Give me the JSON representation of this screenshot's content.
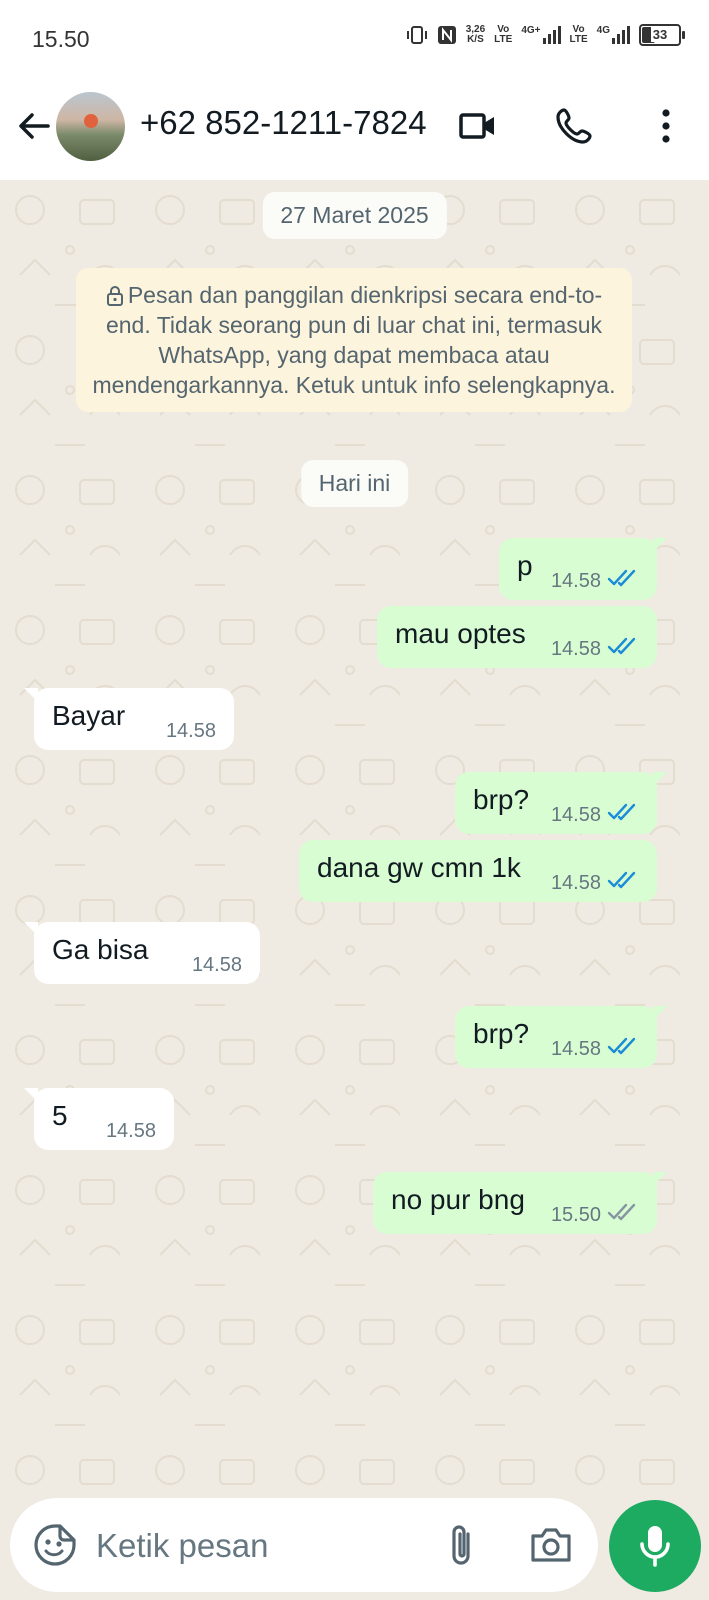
{
  "status_bar": {
    "time": "15.50",
    "net_speed": "3,26",
    "net_unit": "K/S",
    "volte1": "Vo",
    "lte1": "LTE",
    "net1": "4G+",
    "volte2": "Vo",
    "lte2": "LTE",
    "net2": "4G",
    "battery": "33",
    "battery_level": 0.33
  },
  "header": {
    "contact": "+62 852-1211-7824",
    "icons": [
      "back-arrow-icon",
      "video-call-icon",
      "voice-call-icon",
      "more-options-icon"
    ]
  },
  "chat": {
    "date_label": "27 Maret 2025",
    "encryption_notice": "Pesan dan panggilan dienkripsi secara end-to-end. Tidak seorang pun di luar chat ini, termasuk WhatsApp, yang dapat membaca atau mendengarkannya. Ketuk untuk info selengkapnya.",
    "today_label": "Hari ini",
    "messages": [
      {
        "direction": "out",
        "text": "p",
        "time": "14.58",
        "status": "read"
      },
      {
        "direction": "out",
        "text": "mau optes",
        "time": "14.58",
        "status": "read"
      },
      {
        "direction": "in",
        "text": "Bayar",
        "time": "14.58"
      },
      {
        "direction": "out",
        "text": "brp?",
        "time": "14.58",
        "status": "read"
      },
      {
        "direction": "out",
        "text": "dana gw cmn 1k",
        "time": "14.58",
        "status": "read"
      },
      {
        "direction": "in",
        "text": "Ga bisa",
        "time": "14.58"
      },
      {
        "direction": "out",
        "text": "brp?",
        "time": "14.58",
        "status": "read"
      },
      {
        "direction": "in",
        "text": "5",
        "time": "14.58"
      },
      {
        "direction": "out",
        "text": "no pur bng",
        "time": "15.50",
        "status": "delivered"
      }
    ]
  },
  "composer": {
    "placeholder": "Ketik pesan",
    "value": ""
  },
  "colors": {
    "outgoing_bubble": "#d9fdd3",
    "incoming_bubble": "#ffffff",
    "read_ticks": "#1a8cd8",
    "delivered_ticks": "#8696a0",
    "mic_button": "#1daa61",
    "chat_background": "#efeae2"
  }
}
